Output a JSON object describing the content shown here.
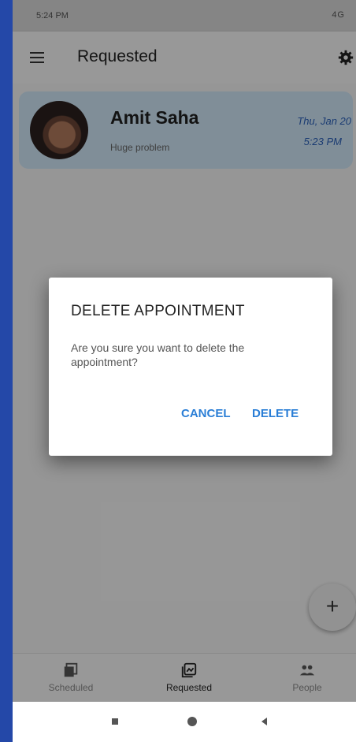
{
  "statusbar": {
    "time": "5:24 PM",
    "system": "4G"
  },
  "appbar": {
    "title": "Requested",
    "menu_icon": "menu-icon",
    "settings_icon": "gear-icon"
  },
  "appointment": {
    "name": "Amit Saha",
    "subtitle": "Huge problem",
    "date": "Thu, Jan 20",
    "time": "5:23 PM",
    "accent_color": "#cfe6f6"
  },
  "fab": {
    "label": "+"
  },
  "bottom_nav": {
    "items": [
      {
        "label": "Scheduled",
        "icon": "scheduled-icon"
      },
      {
        "label": "Requested",
        "icon": "requested-icon"
      },
      {
        "label": "People",
        "icon": "people-icon"
      }
    ],
    "active": "Requested"
  },
  "dialog": {
    "title": "DELETE APPOINTMENT",
    "message": "Are you sure you want to delete the appointment?",
    "cancel_label": "CANCEL",
    "delete_label": "DELETE",
    "button_color": "#2a7ed6"
  }
}
